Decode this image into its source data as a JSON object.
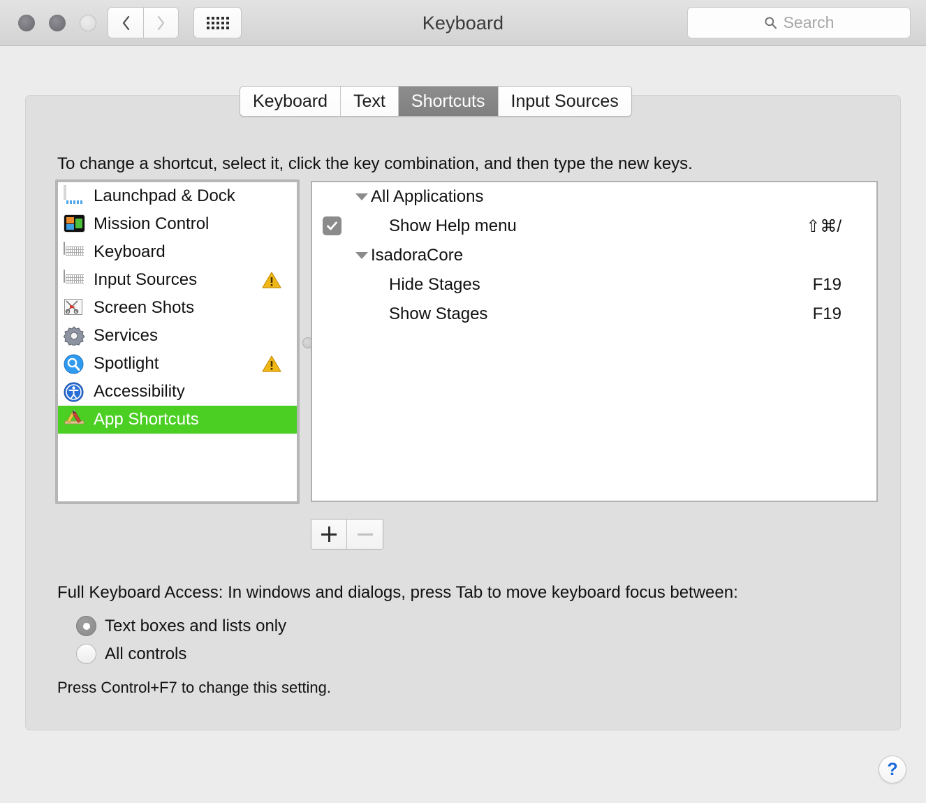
{
  "window": {
    "title": "Keyboard",
    "traffic_lights": [
      "close-button",
      "minimize-button",
      "zoom-button"
    ],
    "nav": {
      "back_icon": "chevron-left-icon",
      "forward_icon": "chevron-right-icon",
      "grid_icon": "show-all-grid-icon"
    },
    "search": {
      "placeholder": "Search",
      "value": "",
      "icon": "search-icon"
    }
  },
  "tabs": [
    {
      "label": "Keyboard",
      "active": false
    },
    {
      "label": "Text",
      "active": false
    },
    {
      "label": "Shortcuts",
      "active": true
    },
    {
      "label": "Input Sources",
      "active": false
    }
  ],
  "instruction": "To change a shortcut, select it, click the key combination, and then type the new keys.",
  "categories": [
    {
      "label": "Launchpad & Dock",
      "icon": "launchpad-dock-icon",
      "selected": false,
      "warning": false
    },
    {
      "label": "Mission Control",
      "icon": "mission-control-icon",
      "selected": false,
      "warning": false
    },
    {
      "label": "Keyboard",
      "icon": "keyboard-icon",
      "selected": false,
      "warning": false
    },
    {
      "label": "Input Sources",
      "icon": "input-sources-icon",
      "selected": false,
      "warning": true
    },
    {
      "label": "Screen Shots",
      "icon": "screen-shots-icon",
      "selected": false,
      "warning": false
    },
    {
      "label": "Services",
      "icon": "services-gear-icon",
      "selected": false,
      "warning": false
    },
    {
      "label": "Spotlight",
      "icon": "spotlight-icon",
      "selected": false,
      "warning": true
    },
    {
      "label": "Accessibility",
      "icon": "accessibility-icon",
      "selected": false,
      "warning": false
    },
    {
      "label": "App Shortcuts",
      "icon": "app-shortcuts-icon",
      "selected": true,
      "warning": false
    }
  ],
  "shortcut_tree": [
    {
      "kind": "group",
      "label": "All Applications",
      "expanded": true
    },
    {
      "kind": "item",
      "label": "Show Help menu",
      "shortcut": "⇧⌘/",
      "checked": true
    },
    {
      "kind": "group",
      "label": "IsadoraCore",
      "expanded": true
    },
    {
      "kind": "item",
      "label": "Hide Stages",
      "shortcut": "F19",
      "checked": false
    },
    {
      "kind": "item",
      "label": "Show Stages",
      "shortcut": "F19",
      "checked": false
    }
  ],
  "list_buttons": {
    "add_label": "+",
    "remove_label": "–",
    "add_enabled": true,
    "remove_enabled": false
  },
  "full_keyboard_access": {
    "label": "Full Keyboard Access: In windows and dialogs, press Tab to move keyboard focus between:",
    "options": [
      {
        "label": "Text boxes and lists only",
        "selected": true
      },
      {
        "label": "All controls",
        "selected": false
      }
    ],
    "note": "Press Control+F7 to change this setting."
  },
  "help": {
    "label": "?",
    "icon": "help-question-icon"
  },
  "colors": {
    "selection_green": "#4ACF22",
    "tab_active_gray": "#808080",
    "warning_yellow": "#F0B816",
    "help_blue": "#1767DD",
    "window_bg": "#ECECEC",
    "content_bg": "#DFDFDF"
  }
}
